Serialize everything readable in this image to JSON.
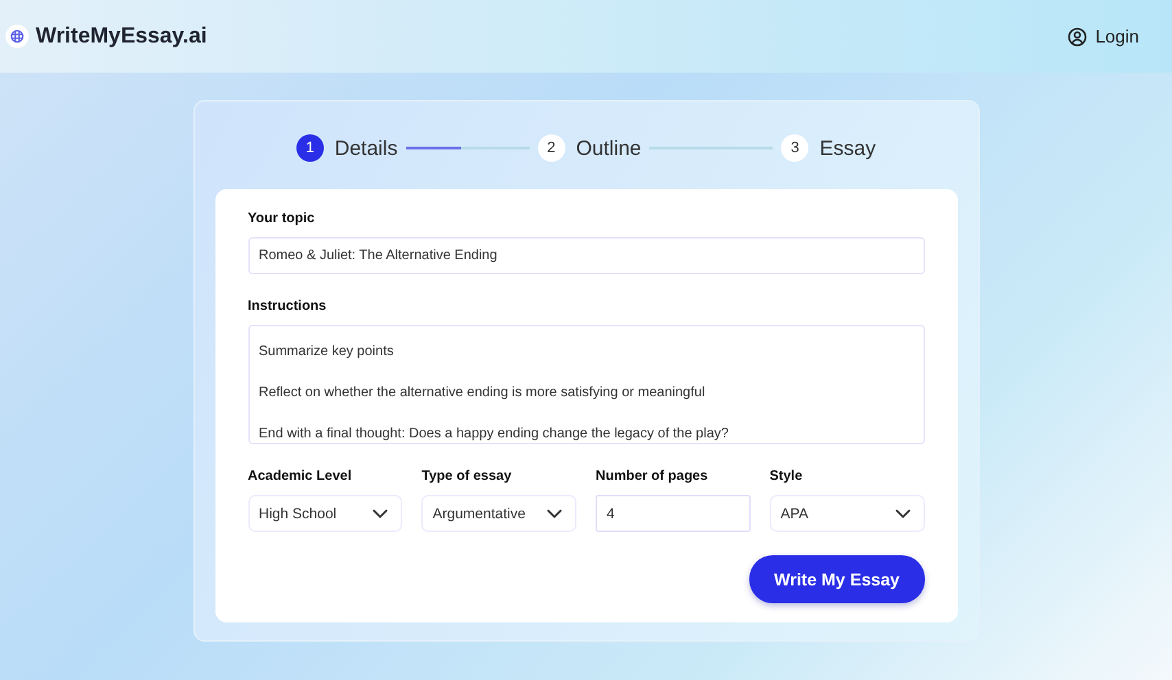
{
  "header": {
    "brand": "WriteMyEssay.ai",
    "login": "Login"
  },
  "steps": [
    {
      "number": "1",
      "label": "Details",
      "selected": true
    },
    {
      "number": "2",
      "label": "Outline",
      "selected": false
    },
    {
      "number": "3",
      "label": "Essay",
      "selected": false
    }
  ],
  "connectors": [
    {
      "level": 0.45
    }
  ],
  "topic": {
    "label": "Your topic",
    "value": "Romeo & Juliet: The Alternative Ending"
  },
  "instructions": {
    "label": "Instructions",
    "lines": [
      "Summarize key points",
      "Reflect on whether the alternative ending is more satisfying or meaningful",
      "End with a final thought: Does a happy ending change the legacy of the play?"
    ]
  },
  "options": [
    {
      "label": "Academic Level",
      "kind": "select",
      "value": "High School"
    },
    {
      "label": "Type of essay",
      "kind": "select",
      "value": "Argumentative"
    },
    {
      "label": "Number of pages",
      "kind": "input",
      "value": "4"
    },
    {
      "label": "Style",
      "kind": "select",
      "value": "APA"
    }
  ],
  "submit": "Write My Essay"
}
